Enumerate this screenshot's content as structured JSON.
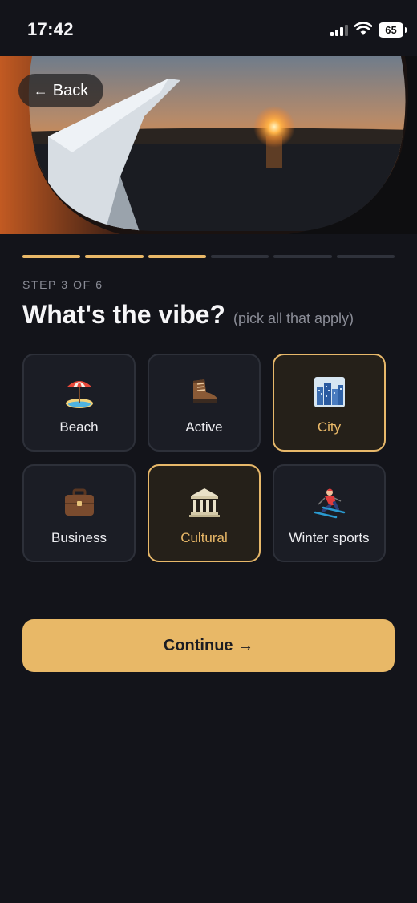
{
  "status_bar": {
    "time": "17:42",
    "battery": "65"
  },
  "hero": {
    "back_label": "Back"
  },
  "progress": {
    "total_steps": 6,
    "completed_steps": 3
  },
  "step": {
    "label": "STEP 3 OF 6"
  },
  "heading": {
    "title": "What's the vibe?",
    "subtitle": "(pick all that apply)"
  },
  "options": [
    {
      "label": "Beach",
      "icon": "beach-umbrella-icon",
      "selected": false
    },
    {
      "label": "Active",
      "icon": "hiking-boot-icon",
      "selected": false
    },
    {
      "label": "City",
      "icon": "cityscape-icon",
      "selected": true
    },
    {
      "label": "Business",
      "icon": "briefcase-icon",
      "selected": false
    },
    {
      "label": "Cultural",
      "icon": "classical-building-icon",
      "selected": true
    },
    {
      "label": "Winter sports",
      "icon": "skier-icon",
      "selected": false
    }
  ],
  "continue": {
    "label": "Continue →"
  },
  "colors": {
    "accent": "#e8b867",
    "background": "#13141a",
    "card": "#1b1d25",
    "card_selected": "#252019"
  }
}
